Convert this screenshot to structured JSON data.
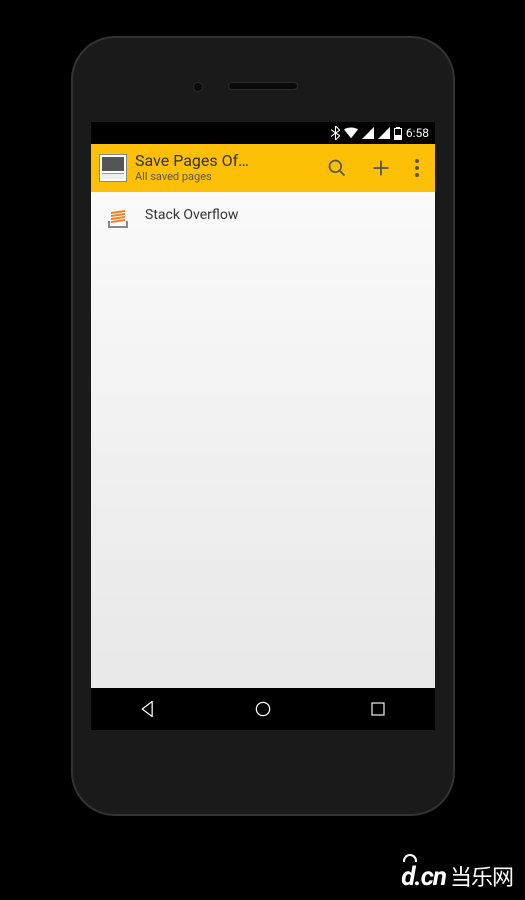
{
  "status_bar": {
    "time": "6:58"
  },
  "app_bar": {
    "title": "Save Pages Of…",
    "subtitle": "All saved pages"
  },
  "list": {
    "items": [
      {
        "label": "Stack Overflow"
      }
    ]
  },
  "watermark": {
    "brand": "d.cn",
    "text": "当乐网"
  }
}
